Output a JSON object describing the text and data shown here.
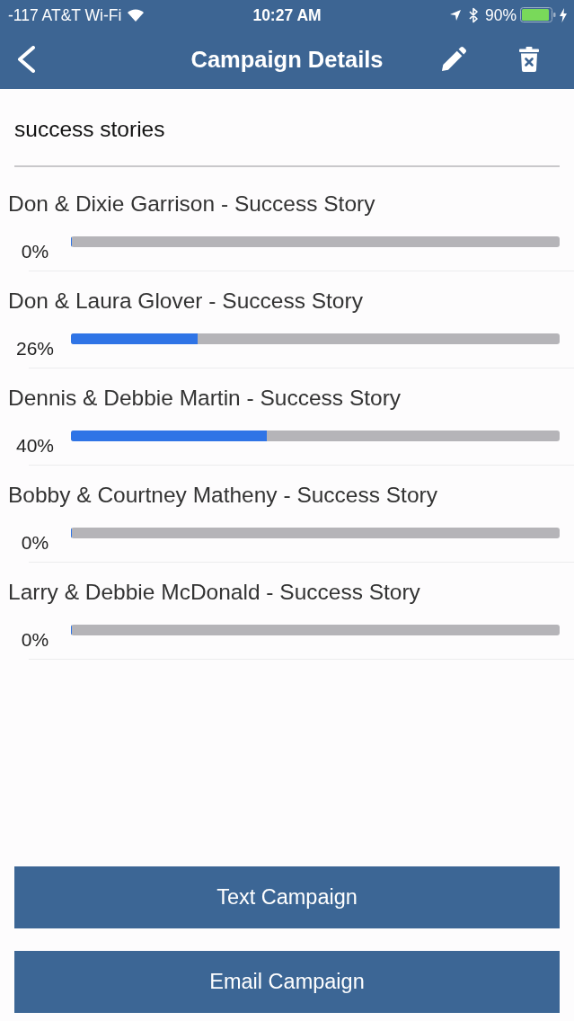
{
  "status_bar": {
    "carrier": "-117 AT&T Wi-Fi",
    "time": "10:27 AM",
    "battery": "90%"
  },
  "nav": {
    "title": "Campaign Details"
  },
  "campaign_name": {
    "value": "success stories"
  },
  "messages": [
    {
      "title": "Don & Dixie Garrison - Success Story",
      "level": 0,
      "reading": "0%"
    },
    {
      "title": "Don & Laura Glover - Success Story",
      "level": 0.26,
      "reading": "26%"
    },
    {
      "title": "Dennis & Debbie Martin - Success Story",
      "level": 0.4,
      "reading": "40%"
    },
    {
      "title": "Bobby & Courtney Matheny - Success Story",
      "level": 0,
      "reading": "0%"
    },
    {
      "title": "Larry & Debbie McDonald - Success Story",
      "level": 0,
      "reading": "0%"
    }
  ],
  "buttons": [
    "Text Campaign",
    "Email Campaign"
  ]
}
